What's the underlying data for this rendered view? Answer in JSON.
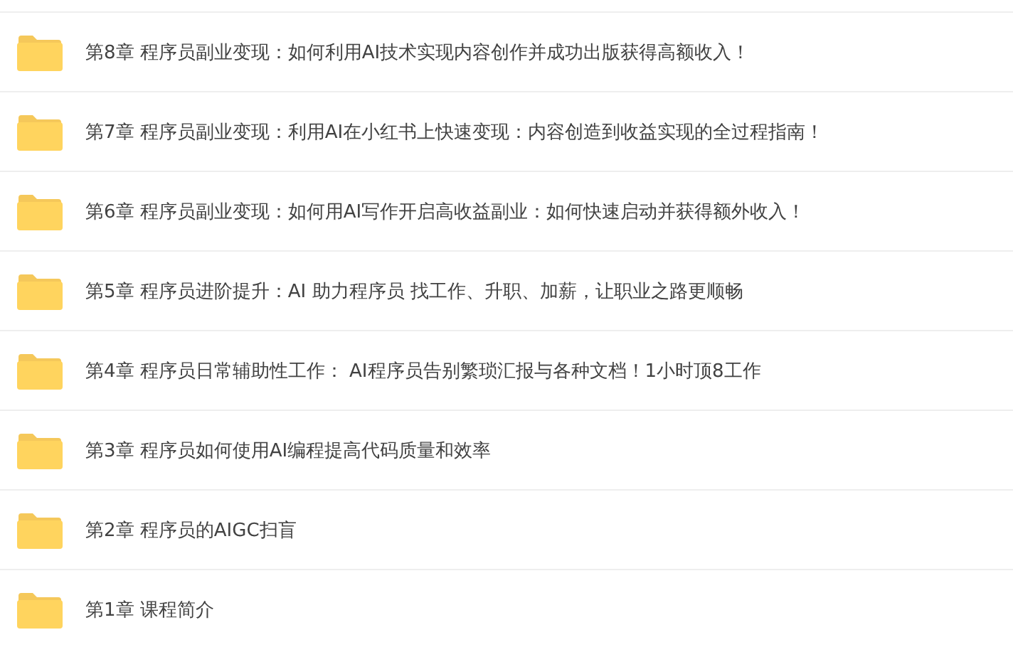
{
  "folders": [
    {
      "name": "第8章 程序员副业变现：如何利用AI技术实现内容创作并成功出版获得高额收入！"
    },
    {
      "name": "第7章 程序员副业变现：利用AI在小红书上快速变现：内容创造到收益实现的全过程指南！"
    },
    {
      "name": "第6章 程序员副业变现：如何用AI写作开启高收益副业：如何快速启动并获得额外收入！"
    },
    {
      "name": "第5章 程序员进阶提升：AI 助力程序员 找工作、升职、加薪，让职业之路更顺畅"
    },
    {
      "name": "第4章 程序员日常辅助性工作： AI程序员告别繁琐汇报与各种文档！1小时顶8工作"
    },
    {
      "name": "第3章 程序员如何使用AI编程提高代码质量和效率"
    },
    {
      "name": "第2章 程序员的AIGC扫盲"
    },
    {
      "name": "第1章 课程简介"
    }
  ]
}
